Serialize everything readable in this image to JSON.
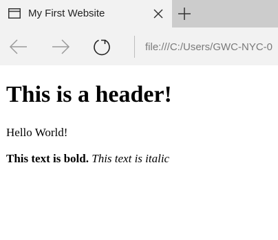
{
  "browser": {
    "tab": {
      "title": "My First Website",
      "page_icon": "page-icon",
      "close_icon": "close-icon"
    },
    "new_tab_icon": "plus-icon",
    "nav": {
      "back_icon": "back-arrow-icon",
      "forward_icon": "forward-arrow-icon",
      "refresh_icon": "refresh-icon"
    },
    "address": "file:///C:/Users/GWC-NYC-0"
  },
  "page": {
    "heading": "This is a header!",
    "paragraph1": "Hello World!",
    "bold_text": "This text is bold.",
    "italic_text": "This text is italic"
  },
  "colors": {
    "tabstrip": "#cccccc",
    "active_tab": "#f2f2f2",
    "toolbar": "#f2f2f2",
    "icon_disabled": "#9a9a9a",
    "icon_active": "#222222",
    "address_text": "#7a7a7a"
  }
}
